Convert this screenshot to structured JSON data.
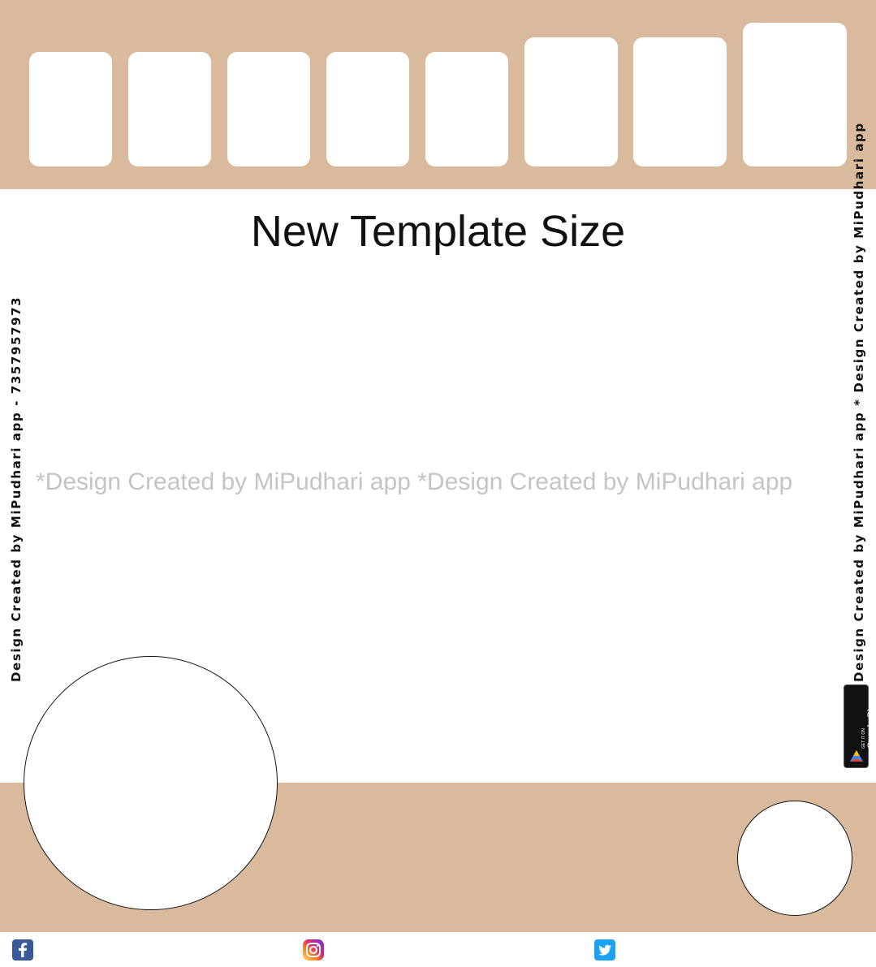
{
  "title": "New Template Size",
  "watermark": "*Design Created by MiPudhari app *Design Created by MiPudhari app",
  "vertical_left": "Design Created by MiPudhari app - 7357957973",
  "vertical_right": "Design Created by MiPudhari app * Design Created by MiPudhari app",
  "badge": {
    "small": "GET IT ON",
    "big": "Google Play"
  },
  "icons": {
    "facebook": "facebook-icon",
    "instagram": "instagram-icon",
    "twitter": "twitter-icon",
    "play": "google-play-icon"
  },
  "colors": {
    "band": "#d9ba9c",
    "watermark": "#c4c4c4",
    "facebook": "#3b5998",
    "twitter": "#1da1f2"
  }
}
